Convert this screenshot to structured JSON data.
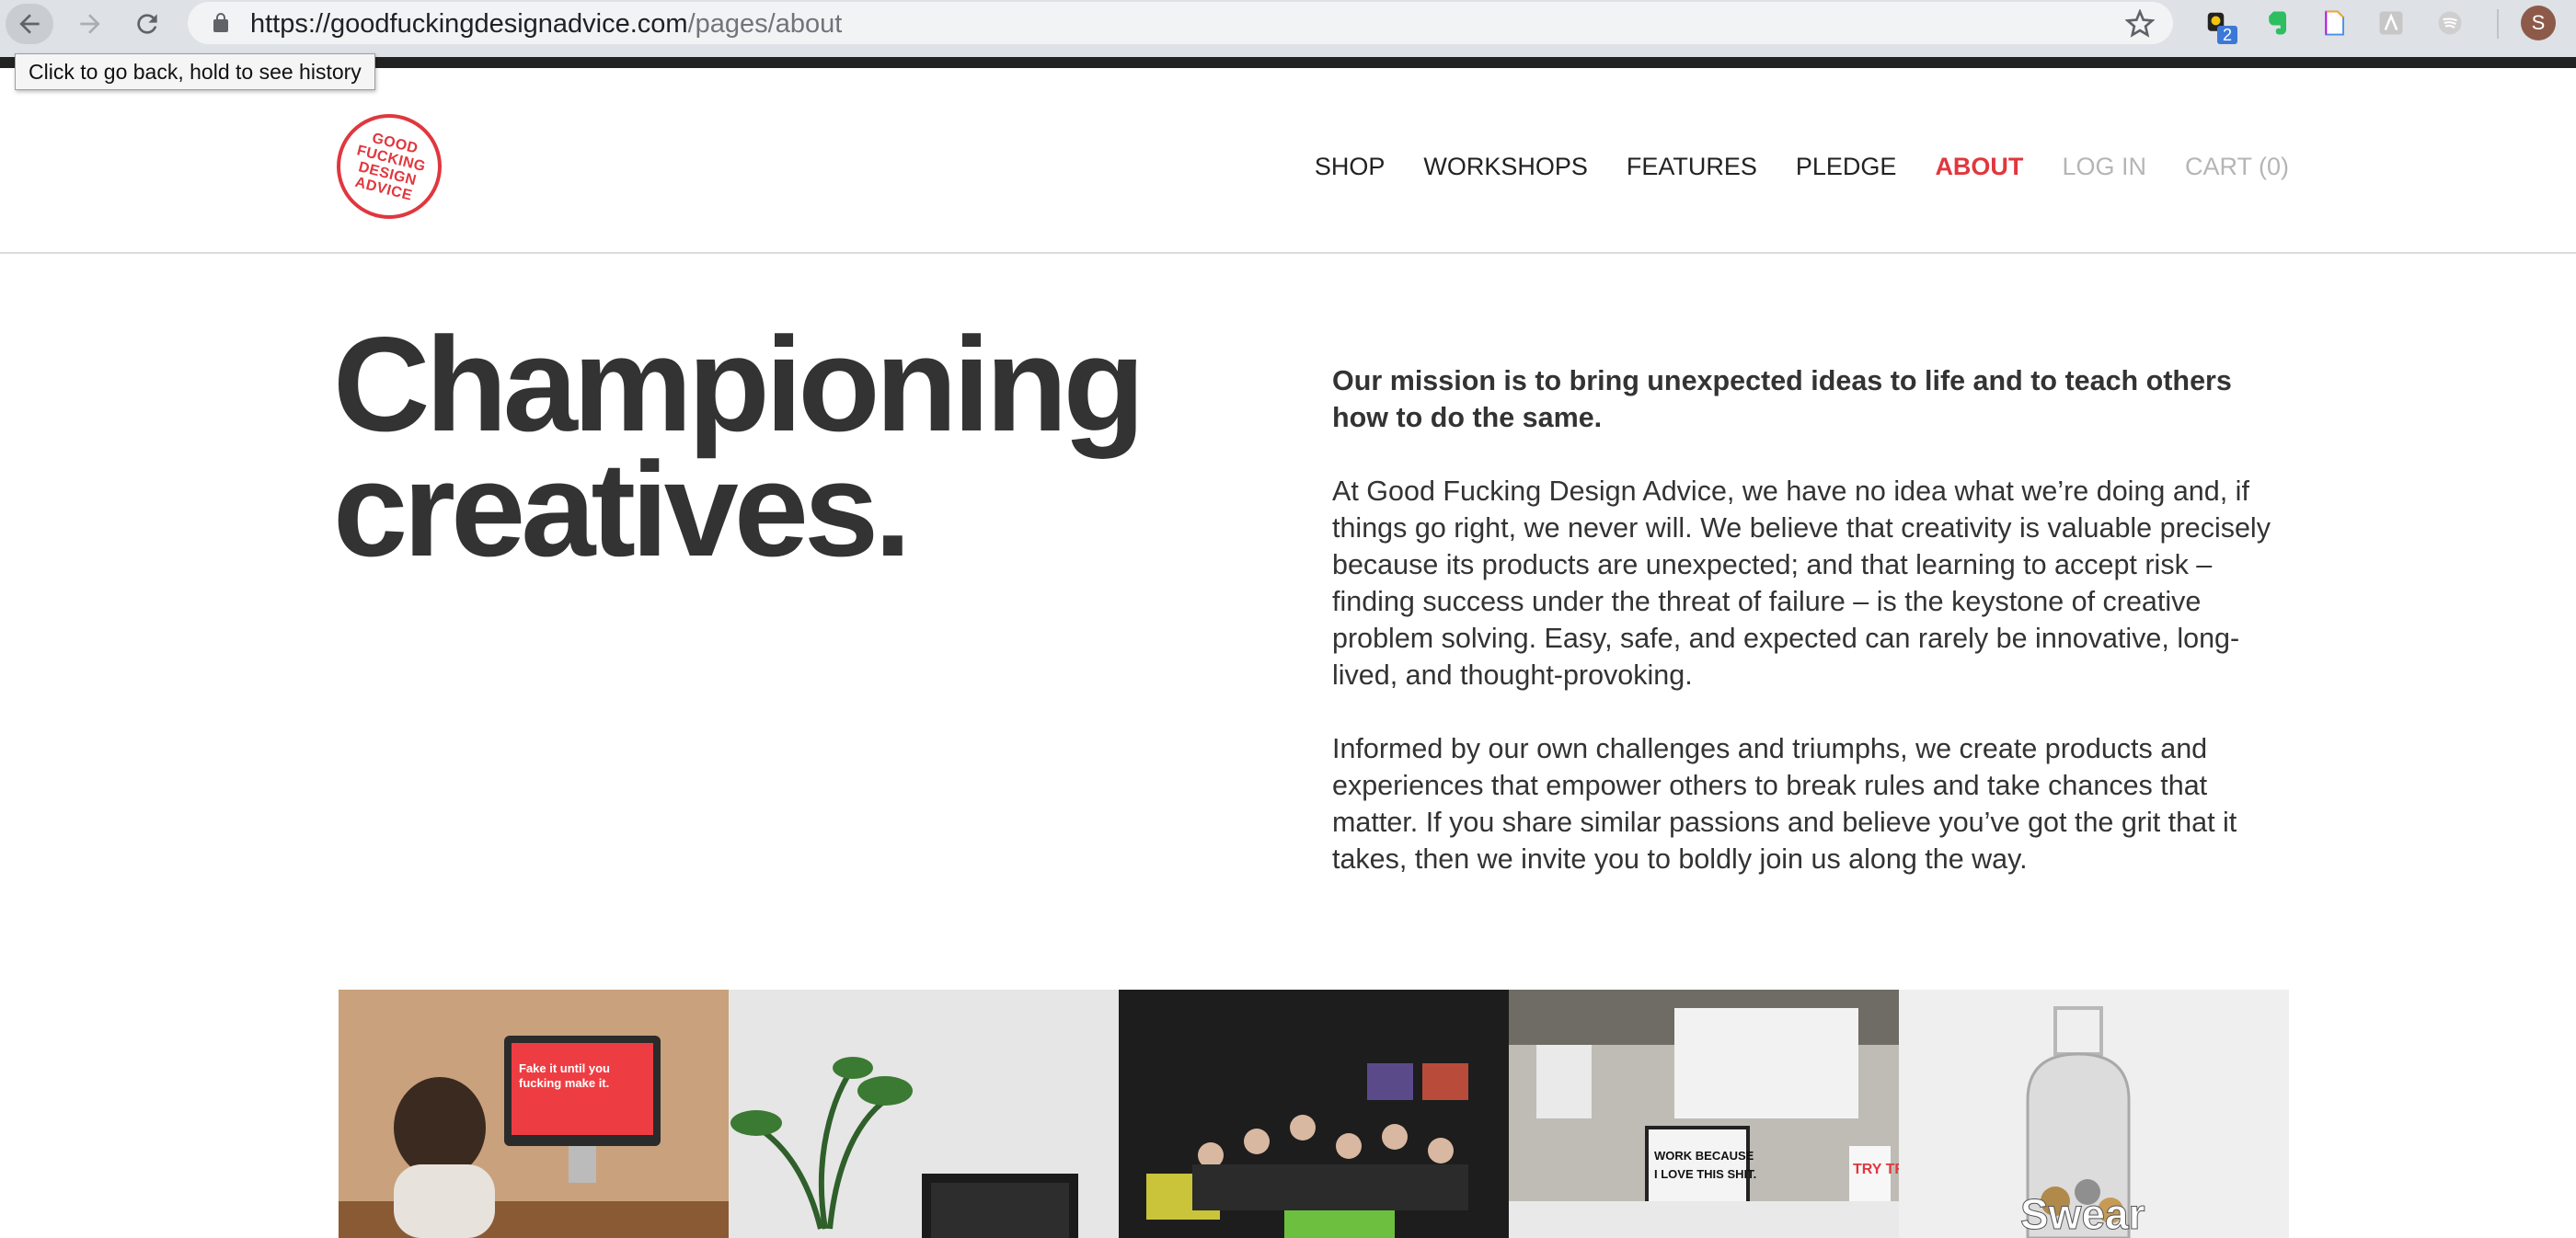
{
  "browser": {
    "url_host": "https://goodfuckingdesignadvice.com",
    "url_path": "/pages/about",
    "tooltip": "Click to go back, hold to see history",
    "extension_badge": "2",
    "profile_initial": "S",
    "icons": [
      "back-arrow-icon",
      "forward-arrow-icon",
      "reload-icon",
      "lock-icon",
      "star-icon",
      "extension-icon",
      "evernote-icon",
      "document-icon",
      "sketch-icon",
      "spotify-icon"
    ]
  },
  "site": {
    "logo_text": "GOOD\nFUCKING\nDESIGN\nADVICE",
    "brand_color": "#e0373e",
    "nav": [
      {
        "label": "SHOP"
      },
      {
        "label": "WORKSHOPS"
      },
      {
        "label": "FEATURES"
      },
      {
        "label": "PLEDGE"
      },
      {
        "label": "ABOUT"
      },
      {
        "label": "LOG IN"
      },
      {
        "label": "CART (0)"
      }
    ]
  },
  "hero": {
    "headline_line1": "Championing",
    "headline_line2": "creatives.",
    "lead": "Our mission is to bring unexpected ideas to life and to teach others how to do the same.",
    "paragraph1": "At Good Fucking Design Advice, we have no idea what we’re doing and, if things go right, we never will. We believe that creativity is valuable precisely because its products are unexpected; and that learning to accept risk – finding success under the threat of failure – is the keystone of creative problem solving. Easy, safe, and expected can rarely be innovative, long-lived, and thought-provoking.",
    "paragraph2": "Informed by our own challenges and triumphs, we create products and experiences that empower others to break rules and take chances that matter. If you share similar passions and believe you’ve got the grit that it takes, then we invite you to boldly join us along the way."
  },
  "photos": {
    "photo1_screen_text_1": "Fake it until you",
    "photo1_screen_text_2": "fucking make it.",
    "photo4_sign_text_1": "WORK BECAUSE",
    "photo4_sign_text_2": "I LOVE THIS SHIT.",
    "photo4_poster_text": "TRY TRY",
    "photo5_jar_text": "Swear"
  }
}
